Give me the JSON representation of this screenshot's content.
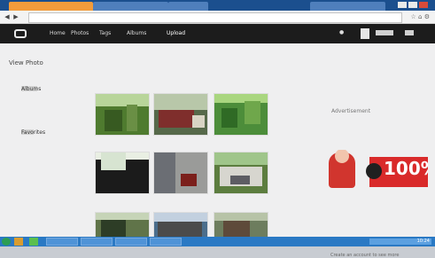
{
  "app": {
    "page_title": "View Photo",
    "ad_label": "Advertisement",
    "ad_percent": "100%",
    "ad_footer": "Create an account to see more"
  },
  "appbar": {
    "nav": [
      "Home",
      "Photos",
      "Tags",
      "Albums",
      "Upload"
    ]
  },
  "sidebar": {
    "items": [
      "Albums",
      "Favorites"
    ]
  },
  "taskbar": {
    "clock": "10:24"
  },
  "colors": {
    "tab_active": "#f39c3b",
    "appbar_bg": "#1c1c1c",
    "taskbar_bg": "#2a79c4",
    "ad_red": "#d92a2a"
  }
}
